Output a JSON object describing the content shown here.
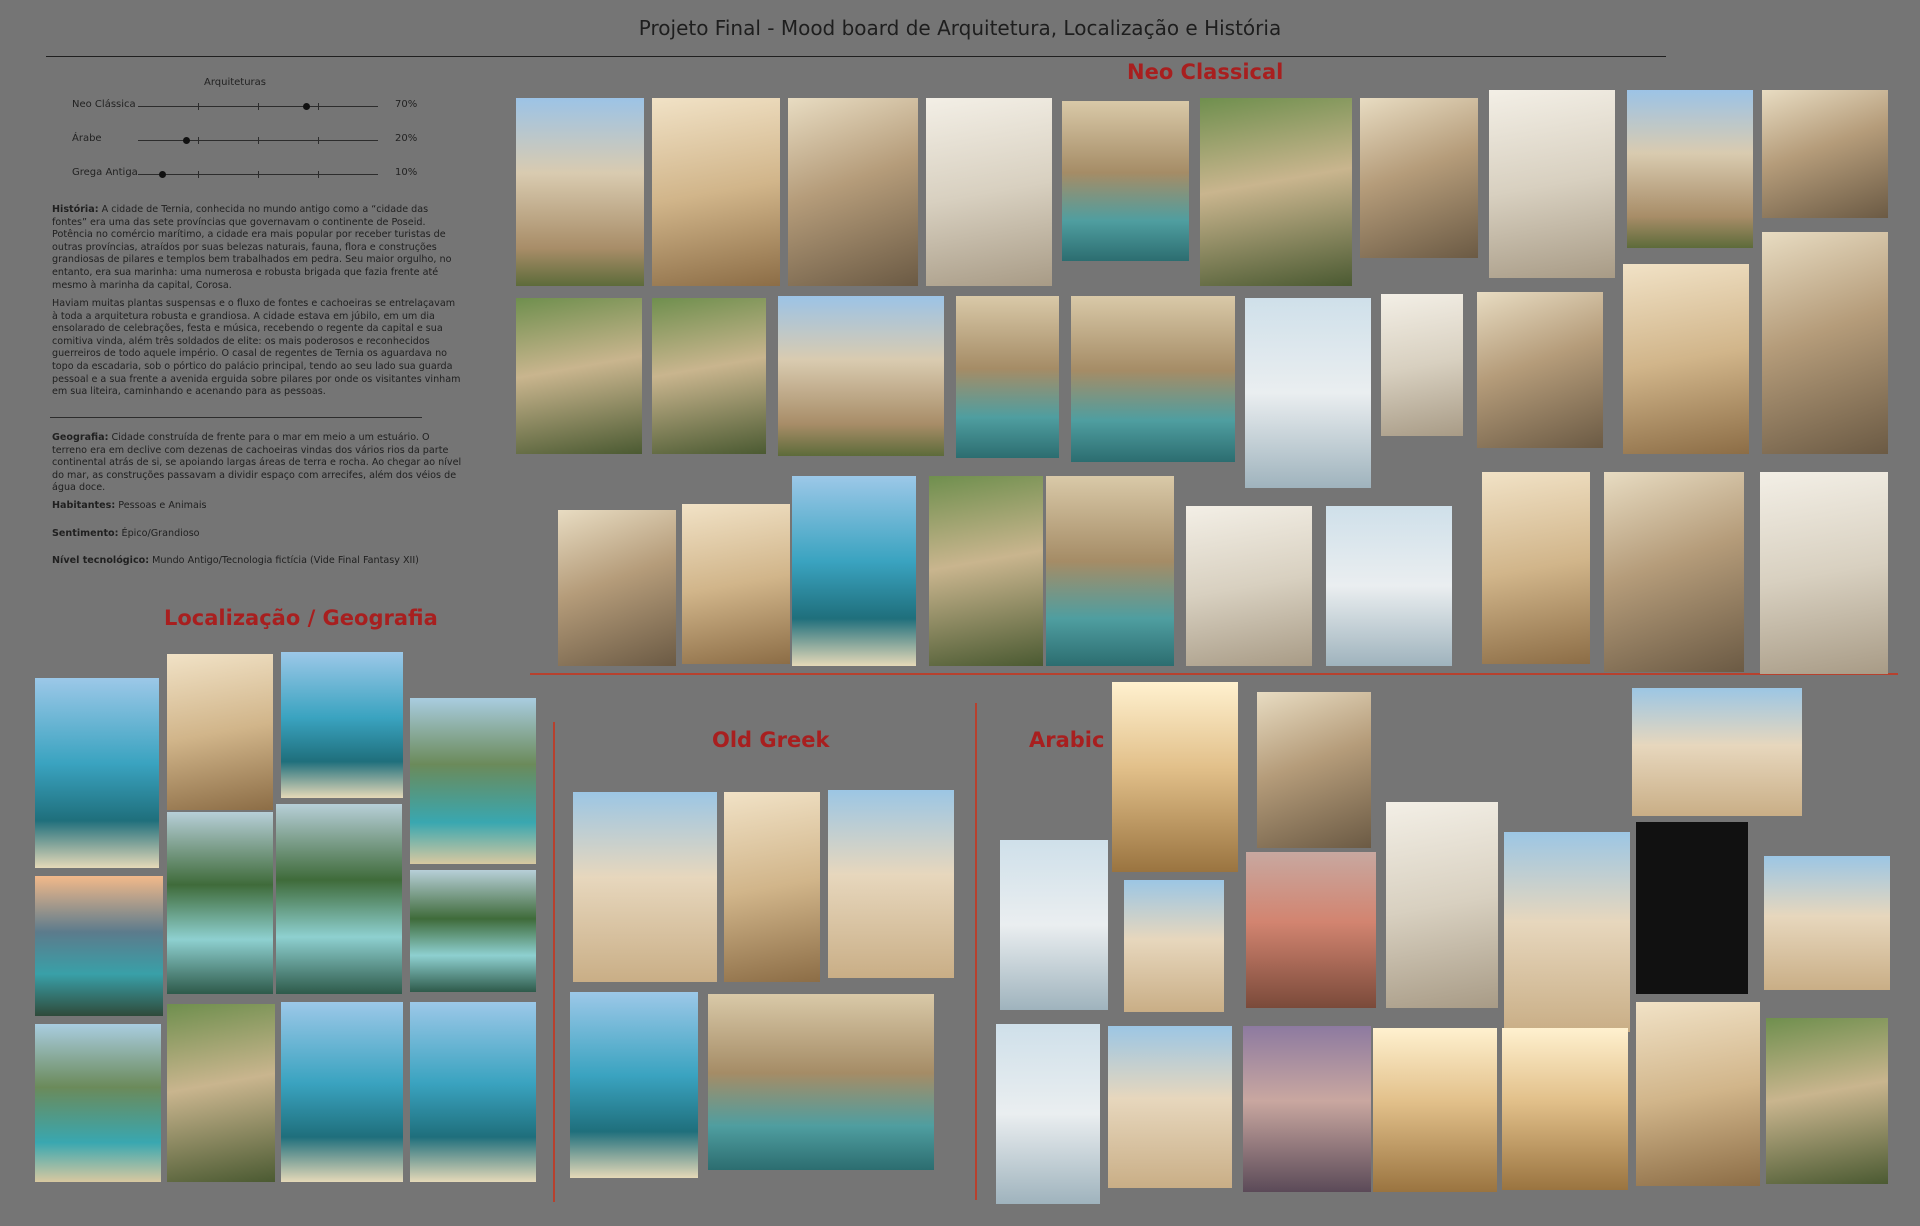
{
  "title": "Projeto Final - Mood board de Arquitetura, Localização e História",
  "sections": {
    "neo_classical": "Neo Classical",
    "localizacao": "Localização / Geografia",
    "old_greek": "Old Greek",
    "arabic": "Arabic"
  },
  "architectures": {
    "heading": "Arquiteturas",
    "rows": [
      {
        "label": "Neo Clássica",
        "value": "70%",
        "level": 0.7
      },
      {
        "label": "Árabe",
        "value": "20%",
        "level": 0.2
      },
      {
        "label": "Grega Antiga",
        "value": "10%",
        "level": 0.1
      }
    ]
  },
  "history": {
    "label": "História:",
    "text": "A cidade de Ternia, conhecida no mundo antigo como a “cidade das fontes” era uma das sete províncias que governavam o continente de Poseid. Potência no comércio marítimo, a cidade era mais popular por receber turistas de outras províncias, atraídos por suas belezas naturais, fauna, flora e construções grandiosas de pilares e templos bem trabalhados em pedra. Seu maior orgulho, no entanto, era sua marinha: uma numerosa e robusta brigada que fazia frente até mesmo à marinha da capital, Corosa.",
    "text2": "Haviam muitas plantas suspensas e o fluxo de fontes e cachoeiras se entrelaçavam à toda a arquitetura robusta e grandiosa. A cidade estava em júbilo, em um dia ensolarado de celebrações, festa e música, recebendo o regente da capital e sua comitiva vinda, além três soldados de elite: os mais poderosos e reconhecidos guerreiros de todo aquele império. O casal de regentes de Ternia os aguardava no topo da escadaria, sob o pórtico do palácio principal, tendo ao seu lado sua guarda pessoal e a sua frente a avenida erguida sobre pilares por onde os visitantes vinham em sua liteira, caminhando e acenando para as pessoas."
  },
  "geography": {
    "label": "Geografia:",
    "text": "Cidade construída de frente para o mar em meio a um estuário. O terreno era em declive com dezenas de cachoeiras vindas dos vários rios da parte continental atrás de si, se apoiando largas áreas de terra e rocha. Ao chegar ao nível do mar, as construções passavam a dividir espaço com arrecifes, além dos véios de água doce."
  },
  "inhabitants": {
    "label": "Habitantes:",
    "text": "Pessoas e Animais"
  },
  "feeling": {
    "label": "Sentimento:",
    "text": "Épico/Grandioso"
  },
  "tech_level": {
    "label": "Nível tecnológico:",
    "text": "Mundo Antigo/Tecnologia fictícia (Vide Final Fantasy XII)"
  },
  "palette": {
    "background": "#757575",
    "accent_red": "#a81f1f",
    "rule_red": "#b7412e"
  }
}
